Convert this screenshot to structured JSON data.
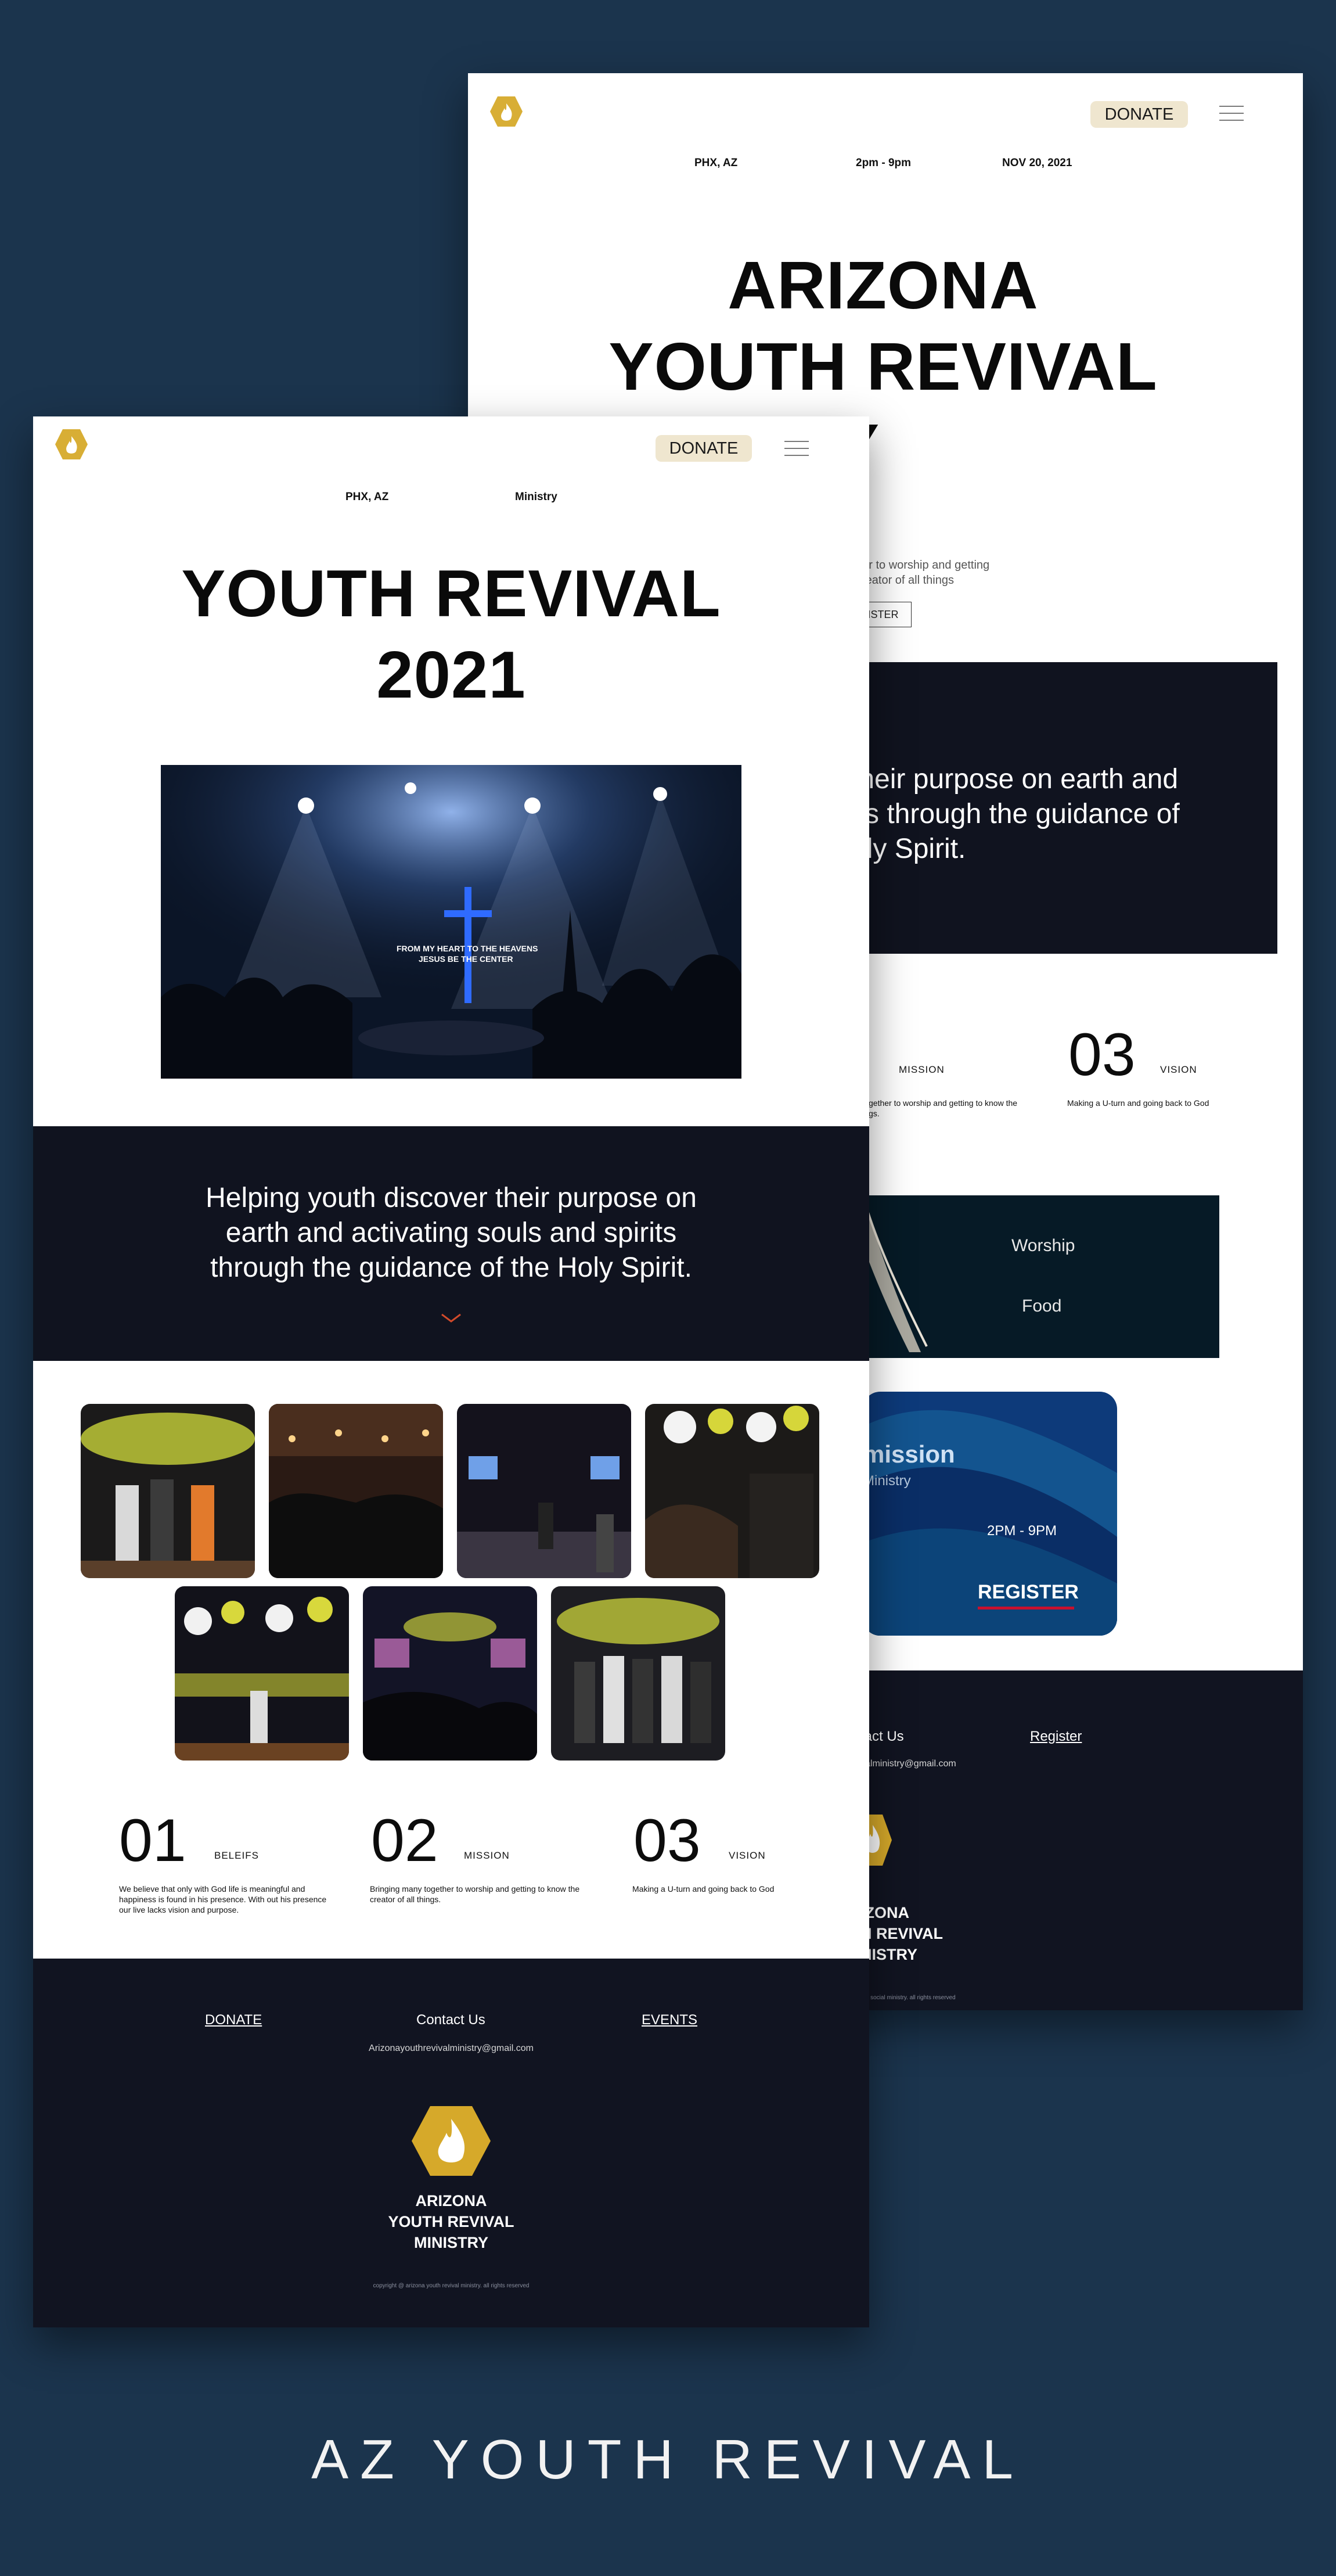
{
  "back_page": {
    "donate_label": "DONATE",
    "meta": {
      "location": "PHX, AZ",
      "time": "2pm - 9pm",
      "date": "NOV 20, 2021"
    },
    "hero": {
      "line1": "ARIZONA",
      "line2": "YOUTH REVIVAL",
      "line3": "STRY"
    },
    "intro_line1": "her to worship and getting",
    "intro_line2": "creator of all things",
    "register_label": "EGISTER",
    "mission_line1": "their purpose on earth and",
    "mission_line2": "its through the guidance of",
    "mission_line3": "oly Spirit.",
    "numbers": {
      "mission_label": "MISSION",
      "mission_desc_line1": "gether to worship and getting to know the",
      "mission_desc_line2": "gs.",
      "vision_number": "03",
      "vision_label": "VISION",
      "vision_desc": "Making a U-turn and going back to God"
    },
    "banner": {
      "item1": "Worship",
      "item2": "Food"
    },
    "event_card": {
      "title": "mission",
      "subtitle": "Ministry",
      "time": "2PM - 9PM",
      "register": "REGISTER"
    },
    "footer": {
      "contact": "tact Us",
      "register_link": "Register",
      "email": "valministry@gmail.com",
      "name_line1": "IZONA",
      "name_line2": "H REVIVAL",
      "name_line3": "NISTRY",
      "copyright": "nt social ministry. all rights reserved"
    }
  },
  "front_page": {
    "donate_label": "DONATE",
    "meta": {
      "location": "PHX, AZ",
      "label": "Ministry"
    },
    "hero": {
      "line1": "YOUTH REVIVAL",
      "line2": "2021"
    },
    "hero_image": {
      "line1": "FROM MY HEART TO THE HEAVENS",
      "line2": "JESUS BE THE CENTER"
    },
    "mission": {
      "line1": "Helping youth discover their purpose on",
      "line2": "earth and activating souls and spirits",
      "line3": "through the guidance of the Holy Spirit."
    },
    "numbers": [
      {
        "number": "01",
        "label": "BELEIFS",
        "desc": [
          "We believe that only with God life is meaningful and",
          "happiness is found in his presence. With out his presence",
          "our live lacks vision and purpose."
        ]
      },
      {
        "number": "02",
        "label": "MISSION",
        "desc": [
          "Bringing many together to worship and getting to know the",
          "creator of all things."
        ]
      },
      {
        "number": "03",
        "label": "VISION",
        "desc": [
          "Making a U-turn and going back to God"
        ]
      }
    ],
    "footer": {
      "donate": "DONATE",
      "contact": "Contact Us",
      "events": "EVENTS",
      "email": "Arizonayouthrevivalministry@gmail.com",
      "name_line1": "ARIZONA",
      "name_line2": "YOUTH REVIVAL",
      "name_line3": "MINISTRY",
      "copyright": "copyright @ arizona youth revival ministry. all rights reserved"
    }
  },
  "brand_text": "AZ YOUTH REVIVAL",
  "colors": {
    "background": "#1b344d",
    "navy": "#10131f",
    "donate_pill": "#efe6cf",
    "gold": "#d6a92a",
    "register_underline": "#c8102e"
  }
}
